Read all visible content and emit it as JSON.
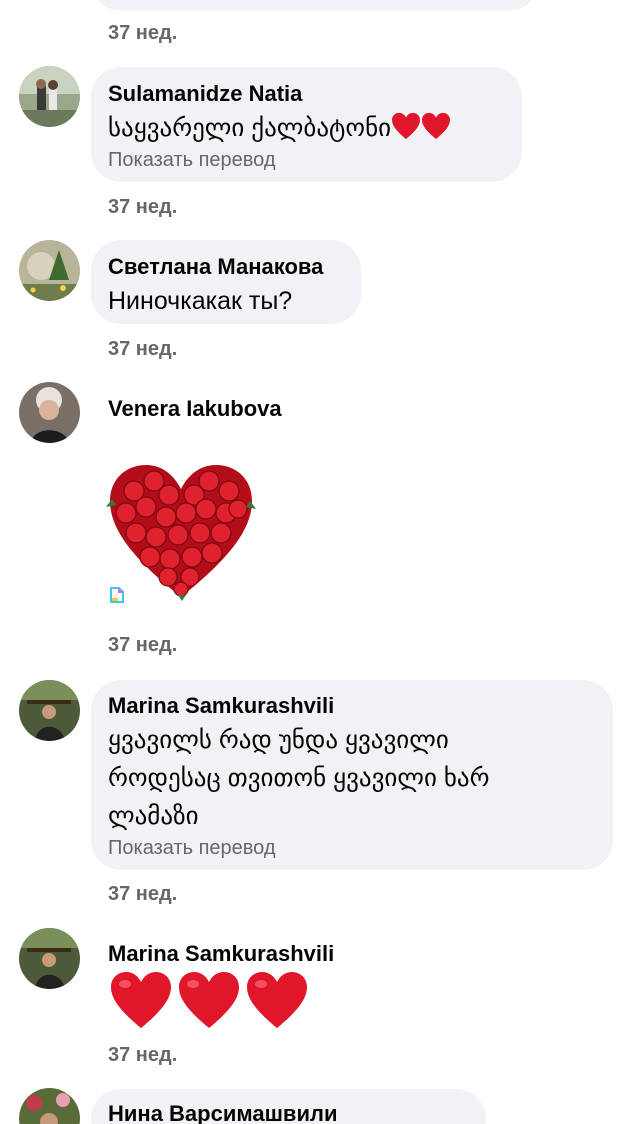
{
  "top_partial": {
    "time": "37 нед."
  },
  "comments": [
    {
      "author": "Sulamanidze Natia",
      "text": "საყვარელი ქალბატონი",
      "translate": "Показать перевод",
      "time": "37 нед."
    },
    {
      "author": "Светлана Манакова",
      "text": "Ниночкакак ты?",
      "time": "37 нед."
    },
    {
      "author": "Venera  Iakubova",
      "sticker": "rose-heart-sticker",
      "time": "37 нед."
    },
    {
      "author": "Marina Samkurashvili",
      "lines": [
        "ყვავილს რად უნდა ყვავილი",
        "როდესაც  თვითონ   ყვავილი ხარ",
        "ლამაზი"
      ],
      "translate": "Показать перевод",
      "time": "37 нед."
    },
    {
      "author": "Marina Samkurashvili",
      "emoji": "three-red-hearts",
      "time": "37 нед."
    },
    {
      "author": "Нина Варсимашвили"
    }
  ],
  "colors": {
    "bubble": "#f0f2f5",
    "meta": "#65676b",
    "text": "#050505",
    "heart": "#e0162b"
  }
}
